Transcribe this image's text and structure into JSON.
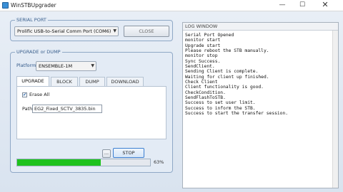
{
  "window": {
    "title": "WinSTBUpgrader",
    "min_icon": "minimize-icon",
    "max_icon": "maximize-icon",
    "close_icon": "close-icon",
    "min_glyph": "—",
    "max_glyph": "☐",
    "close_glyph": "✕"
  },
  "serial_port": {
    "legend": "SERIAL PORT",
    "port_value": "Prolific USB-to-Serial Comm Port (COM6)",
    "close_label": "CLOSE"
  },
  "upgrade": {
    "legend": "UPGRADE or DUMP",
    "platform_label": "Platform",
    "platform_value": "ENSEMBLE-1M",
    "tabs": [
      {
        "label": "UPGRADE",
        "active": true
      },
      {
        "label": "BLOCK",
        "active": false
      },
      {
        "label": "DUMP",
        "active": false
      },
      {
        "label": "DOWNLOAD",
        "active": false
      }
    ],
    "erase_all_label": "Erase All",
    "erase_all_checked": true,
    "path_label": "Path",
    "path_value": "EG2_Fixed_SCTV_3835.bin",
    "browse_label": "...",
    "stop_label": "STOP",
    "progress_percent": 63,
    "progress_text": "63%",
    "progress_color": "#1ec21e"
  },
  "log": {
    "title": "LOG WINDOW",
    "lines": [
      "Serial Port Opened",
      "monitor start",
      "Upgrade start",
      "Please reboot the STB manually.",
      "monitor stop",
      "Sync Success.",
      "SendClient.",
      "Sending Client is complete.",
      "Waiting for client up finished.",
      "Check Client",
      "Client functionality is good.",
      "CheckCondition.",
      "SendFlashToSTB.",
      "Success to set user limit.",
      "Success to inform the STB.",
      "Success to start the transfer session."
    ]
  }
}
